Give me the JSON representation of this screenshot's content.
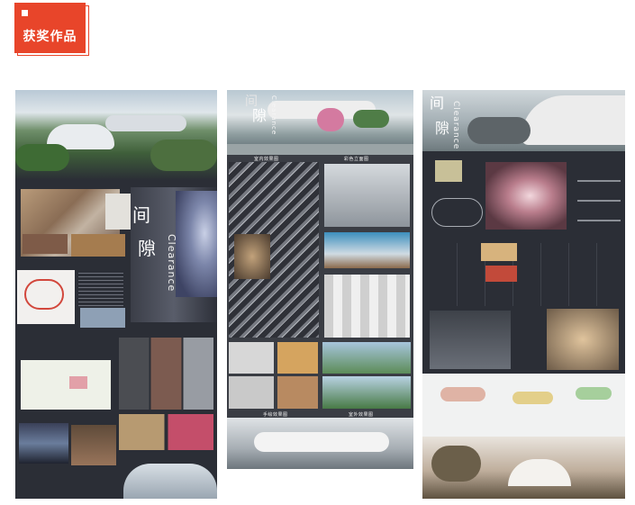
{
  "badge": {
    "title": "获奖作品"
  },
  "posters": {
    "poster1": {
      "title_char1": "间",
      "title_char2": "隙",
      "title_en": "Clearance"
    },
    "poster2": {
      "title_char1": "间",
      "title_char2": "隙",
      "title_en": "Clearance",
      "section_interior": "室内效果图",
      "section_color": "彩色立面图",
      "section_sketch": "手绘效果图",
      "section_outdoor": "室外效果图"
    },
    "poster3": {
      "title_char1": "间",
      "title_char2": "隙",
      "title_en": "Clearance"
    }
  },
  "colors": {
    "accent": "#e8452a",
    "poster_dark": "#2b2e36"
  }
}
